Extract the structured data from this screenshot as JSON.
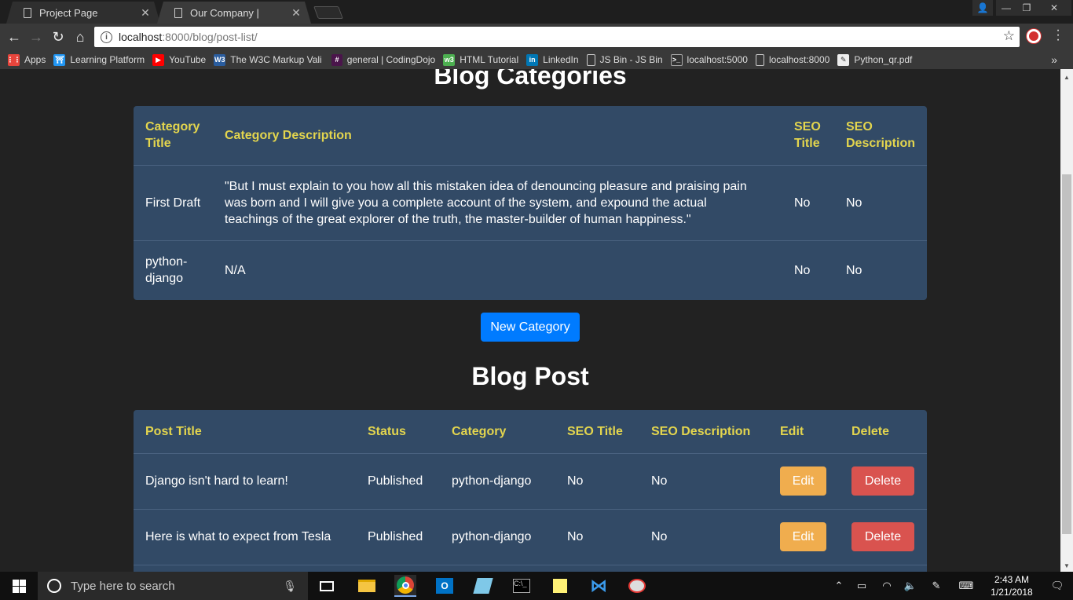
{
  "browser": {
    "tabs": [
      {
        "title": "Project Page",
        "active": false
      },
      {
        "title": "Our Company |",
        "active": true
      }
    ],
    "address": {
      "host": "localhost",
      "path": ":8000/blog/post-list/"
    },
    "bookmarks": [
      {
        "label": "Apps",
        "icon": "apps-grid-icon",
        "color": "#e8453c"
      },
      {
        "label": "Learning Platform",
        "icon": "learning-platform-icon",
        "color": "#2196f3"
      },
      {
        "label": "YouTube",
        "icon": "youtube-icon",
        "color": "#ff0000"
      },
      {
        "label": "The W3C Markup Vali",
        "icon": "w3c-icon",
        "color": "#2a5d9f"
      },
      {
        "label": "general | CodingDojo",
        "icon": "slack-icon",
        "color": "#4a154b"
      },
      {
        "label": "HTML Tutorial",
        "icon": "w3schools-icon",
        "color": "#4caf50"
      },
      {
        "label": "LinkedIn",
        "icon": "linkedin-icon",
        "color": "#0077b5"
      },
      {
        "label": "JS Bin - JS Bin",
        "icon": "page-icon",
        "color": "#555555"
      },
      {
        "label": "localhost:5000",
        "icon": "terminal-icon",
        "color": "#333333"
      },
      {
        "label": "localhost:8000",
        "icon": "page-icon",
        "color": "#555555"
      },
      {
        "label": "Python_qr.pdf",
        "icon": "pdf-icon",
        "color": "#444444"
      }
    ]
  },
  "categories": {
    "heading": "Blog Categories",
    "headers": [
      "Category Title",
      "Category Description",
      "SEO Title",
      "SEO Description"
    ],
    "rows": [
      {
        "title": "First Draft",
        "description": "\"But I must explain to you how all this mistaken idea of denouncing pleasure and praising pain was born and I will give you a complete account of the system, and expound the actual teachings of the great explorer of the truth, the master-builder of human happiness.\"",
        "seo_title": "No",
        "seo_description": "No"
      },
      {
        "title": "python-django",
        "description": "N/A",
        "seo_title": "No",
        "seo_description": "No"
      }
    ],
    "new_button": "New Category"
  },
  "posts": {
    "heading": "Blog Post",
    "headers": [
      "Post Title",
      "Status",
      "Category",
      "SEO Title",
      "SEO Description",
      "Edit",
      "Delete"
    ],
    "rows": [
      {
        "title": "Django isn't hard to learn!",
        "status": "Published",
        "category": "python-django",
        "seo_title": "No",
        "seo_description": "No",
        "edit": "Edit",
        "delete": "Delete"
      },
      {
        "title": "Here is what to expect from Tesla",
        "status": "Published",
        "category": "python-django",
        "seo_title": "No",
        "seo_description": "No",
        "edit": "Edit",
        "delete": "Delete"
      }
    ]
  },
  "taskbar": {
    "search_placeholder": "Type here to search",
    "time": "2:43 AM",
    "date": "1/21/2018"
  },
  "colors": {
    "card": "#324a66",
    "header_text": "#e3d54e",
    "primary": "#007bff",
    "warning": "#f0ad4e",
    "danger": "#d9534f"
  }
}
